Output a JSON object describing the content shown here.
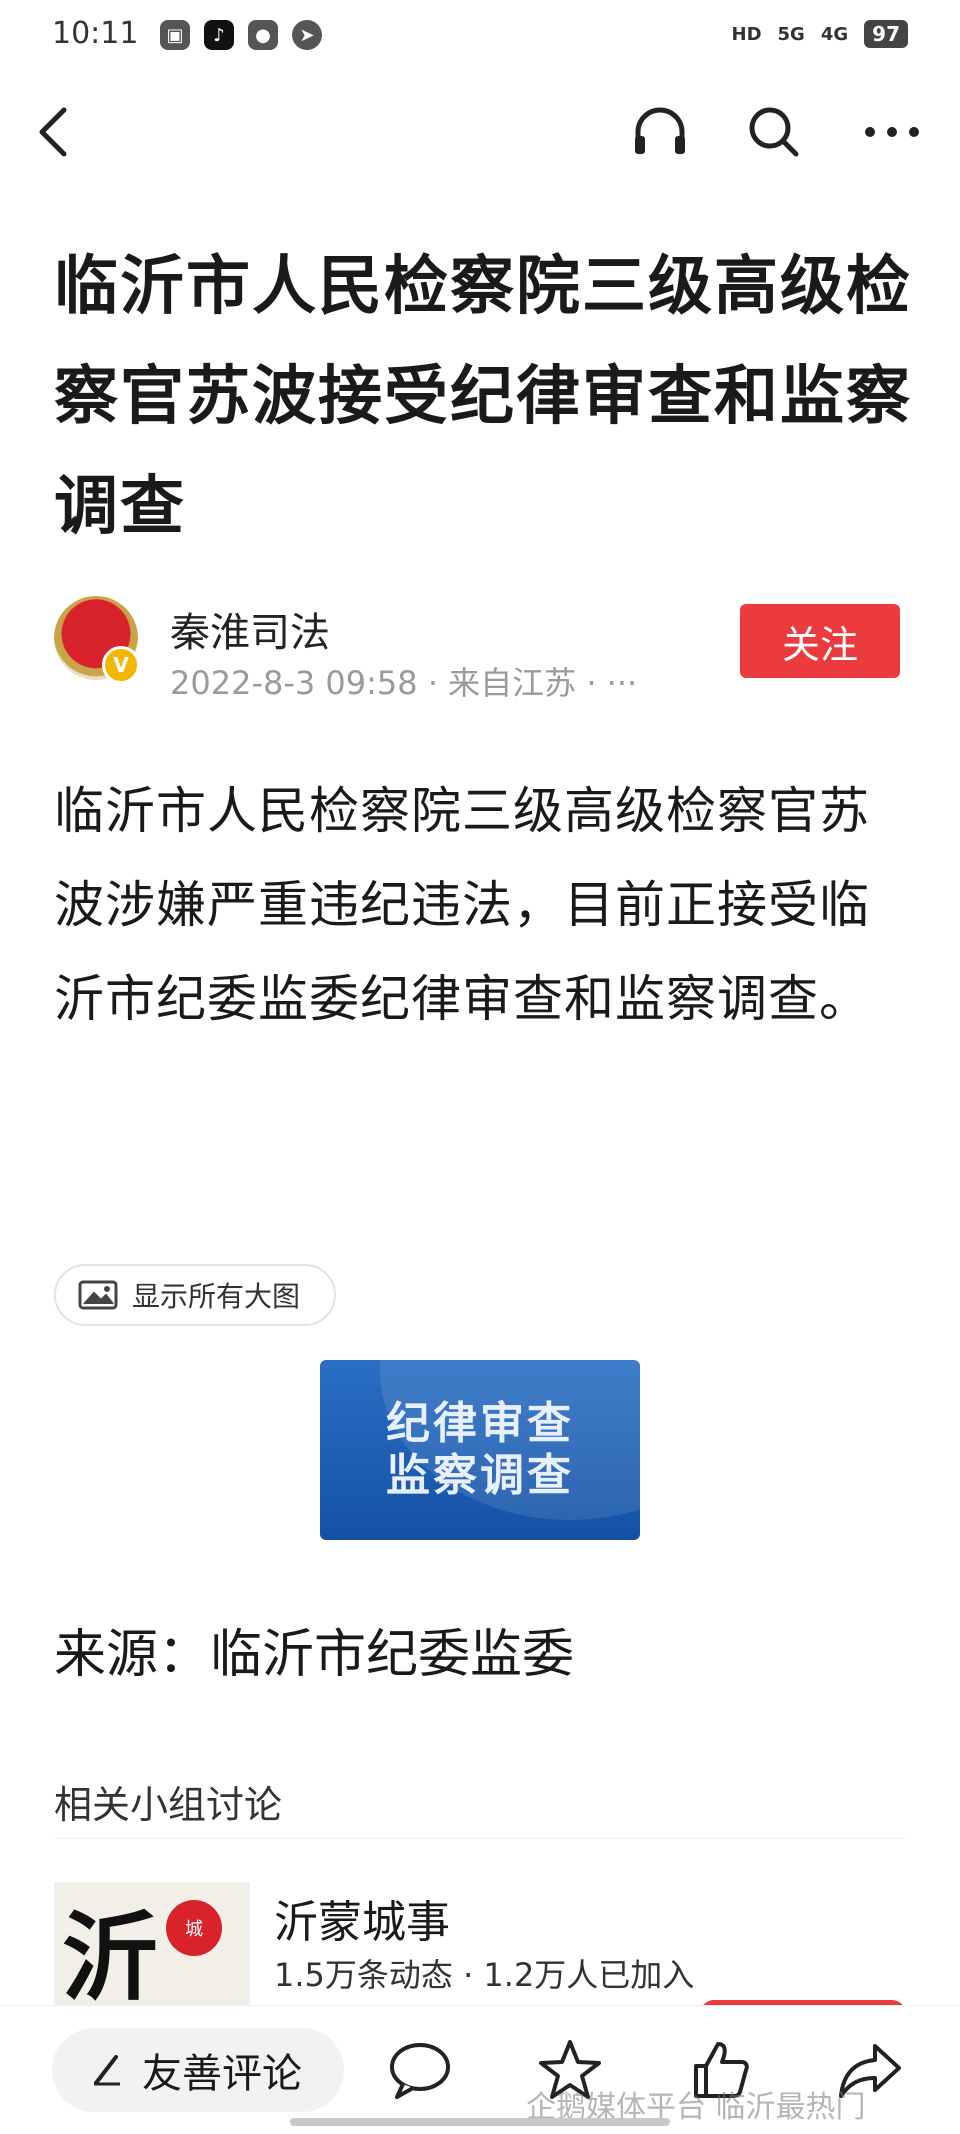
{
  "status_bar": {
    "time": "10:11",
    "app_icons": [
      "sim-manager-icon",
      "tiktok-icon",
      "wechat-icon",
      "compass-icon"
    ],
    "network": [
      "HD",
      "5G",
      "4G"
    ],
    "battery": "97"
  },
  "nav": {
    "icons": [
      "back-icon",
      "headphones-icon",
      "search-icon",
      "more-icon"
    ]
  },
  "article": {
    "title": "临沂市人民检察院三级高级检察官苏波接受纪律审查和监察调查",
    "author": {
      "name": "秦淮司法",
      "meta": "2022-8-3 09:58 · 来自江苏 · ···",
      "verified_badge": "V"
    },
    "follow_label": "关注",
    "body": "临沂市人民检察院三级高级检察官苏波涉嫌严重违纪违法，目前正接受临沂市纪委监委纪律审查和监察调查。",
    "show_images_label": "显示所有大图",
    "image_text": [
      "纪律审查",
      "监察调查"
    ],
    "source": "来源：临沂市纪委监委"
  },
  "related": {
    "section_title": "相关小组讨论",
    "group": {
      "name": "沂蒙城事",
      "stats": "1.5万条动态 · 1.2万人已加入"
    }
  },
  "bottom_bar": {
    "comment_label": "友善评论",
    "icons": [
      "comment-icon",
      "star-icon",
      "thumbs-up-icon",
      "share-icon"
    ],
    "watermark": "企鹅媒体平台 临沂最热门"
  },
  "colors": {
    "accent_red": "#ec3b3e",
    "image_blue": "#1f5fb8"
  }
}
